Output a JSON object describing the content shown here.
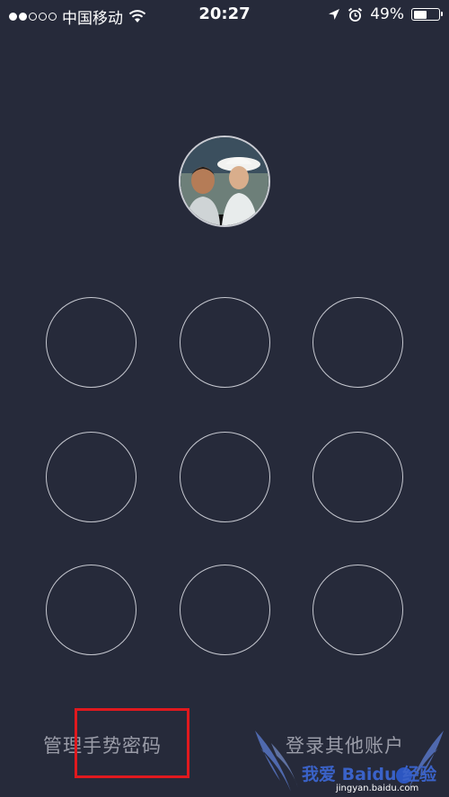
{
  "status_bar": {
    "carrier": "中国移动",
    "time": "20:27",
    "battery_percent": "49%",
    "battery_level": 0.49,
    "signal_bars_filled": 2,
    "signal_bars_total": 5
  },
  "icons": {
    "wifi": "wifi-icon",
    "location": "location-arrow-icon",
    "alarm": "alarm-clock-icon",
    "battery": "battery-icon"
  },
  "bottom": {
    "manage_gesture_label": "管理手势密码",
    "other_account_label": "登录其他账户"
  },
  "watermark": {
    "text": "我爱 Baidu 经验",
    "url": "jingyan.baidu.com"
  },
  "colors": {
    "background": "#262a3a",
    "node_stroke": "#c6c8d0",
    "link_text": "#9a9ca8",
    "highlight": "#e0191e"
  }
}
